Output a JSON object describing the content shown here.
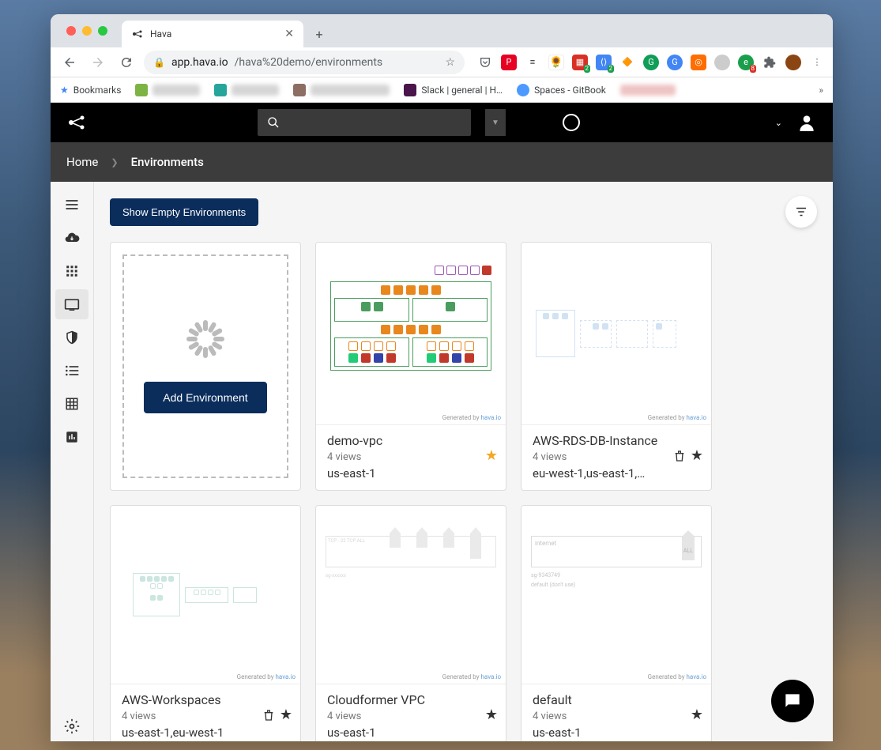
{
  "browser": {
    "tab_title": "Hava",
    "url_host": "app.hava.io",
    "url_path": "/hava%20demo/environments"
  },
  "bookmarks": {
    "label": "Bookmarks",
    "slack": "Slack | general | H…",
    "spaces": "Spaces - GitBook"
  },
  "breadcrumb": {
    "home": "Home",
    "current": "Environments"
  },
  "toolbar": {
    "show_empty": "Show Empty Environments",
    "add_env": "Add Environment"
  },
  "generated_by": "Generated by",
  "generated_link": "hava.io",
  "environments": [
    {
      "title": "demo-vpc",
      "views": "4 views",
      "region": "us-east-1",
      "starred": true,
      "trash": false
    },
    {
      "title": "AWS-RDS-DB-Instance",
      "views": "4 views",
      "region": "eu-west-1,us-east-1,…",
      "starred": true,
      "trash": true
    },
    {
      "title": "AWS-Workspaces",
      "views": "4 views",
      "region": "us-east-1,eu-west-1",
      "starred": true,
      "trash": true
    },
    {
      "title": "Cloudformer VPC",
      "views": "4 views",
      "region": "us-east-1",
      "starred": true,
      "trash": false
    },
    {
      "title": "default",
      "views": "4 views",
      "region": "us-east-1",
      "starred": true,
      "trash": false
    }
  ]
}
